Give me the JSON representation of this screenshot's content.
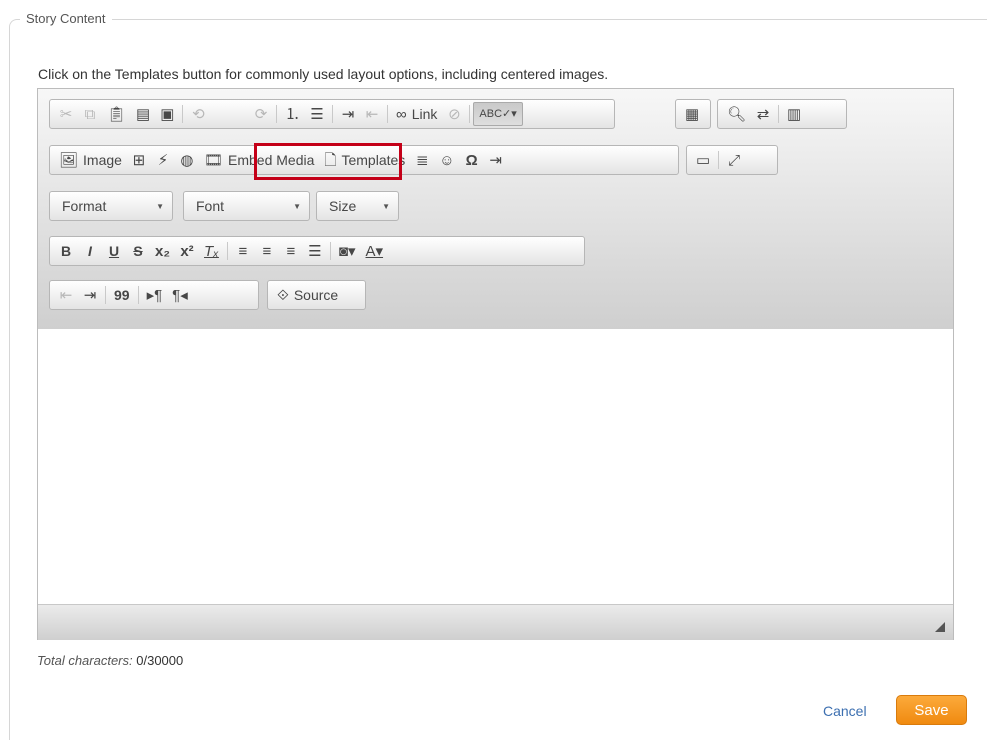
{
  "legend": "Story Content",
  "instructions": "Click on the Templates button for commonly used layout options, including centered images.",
  "toolbar": {
    "link_label": "Link",
    "image_label": "Image",
    "embed_media_label": "Embed Media",
    "templates_label": "Templates",
    "source_label": "Source",
    "format_label": "Format",
    "font_label": "Font",
    "size_label": "Size",
    "bold": "B",
    "italic": "I",
    "underline": "U",
    "strike": "S",
    "blockquote": "99"
  },
  "counter": {
    "label": "Total characters:",
    "value": "0/30000"
  },
  "actions": {
    "cancel": "Cancel",
    "save": "Save"
  },
  "colors": {
    "highlight": "#c40018",
    "save": "#f39a1f",
    "link": "#3c6fb0"
  }
}
